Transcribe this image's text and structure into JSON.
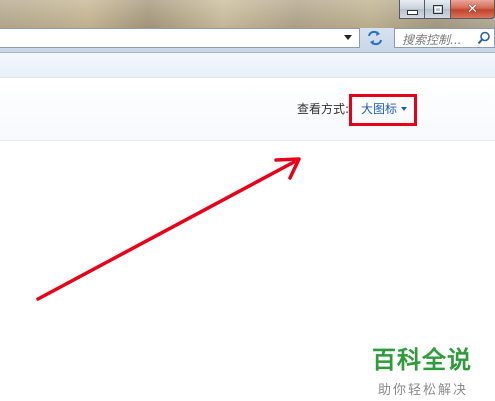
{
  "address_bar": {
    "search_placeholder": "搜索控制..."
  },
  "control_panel": {
    "view_by_label": "查看方式:",
    "view_by_value": "大图标"
  },
  "annotation": {
    "highlight_color": "#e8001a"
  },
  "watermark": {
    "title": "百科全说",
    "subtitle": "助你轻松解决"
  }
}
